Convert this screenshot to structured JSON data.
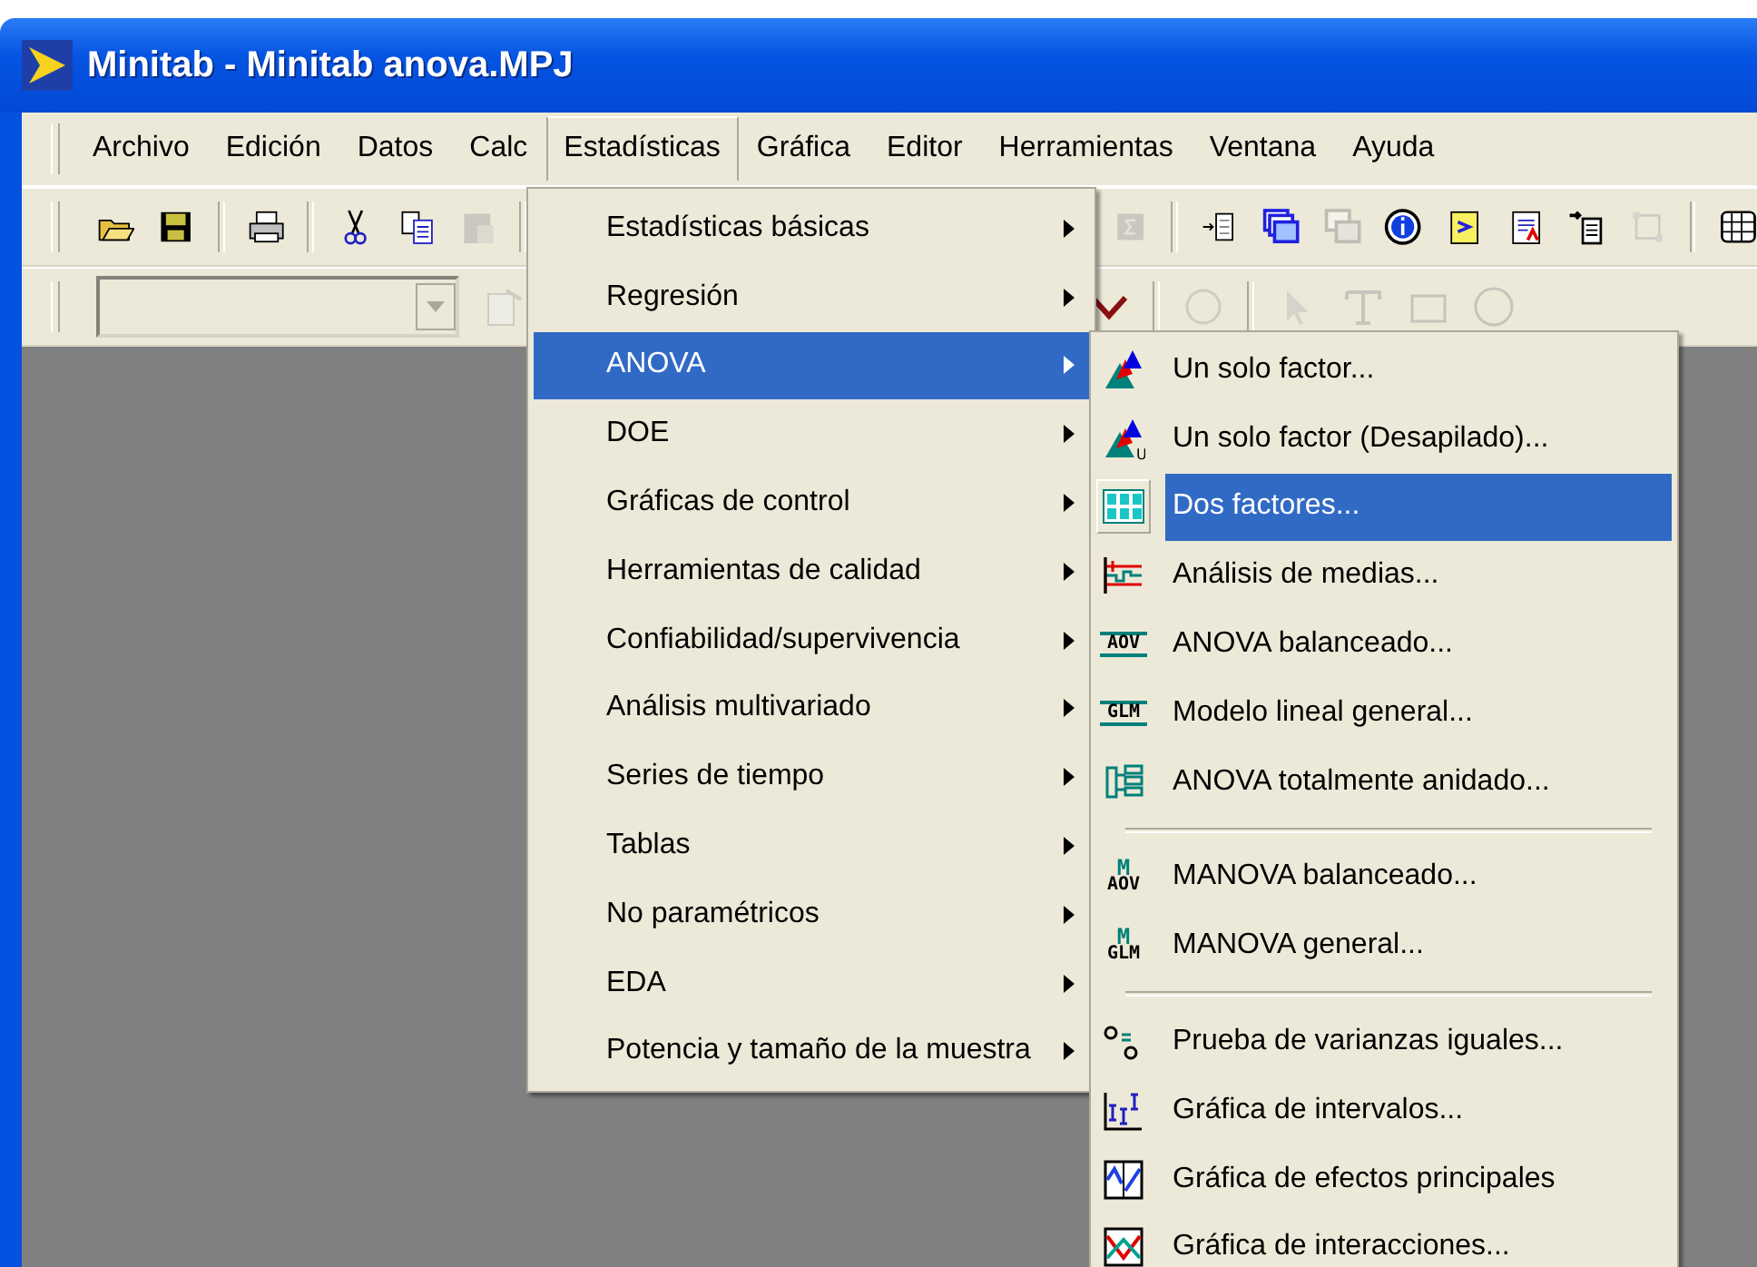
{
  "window": {
    "title": "Minitab - Minitab anova.MPJ"
  },
  "menu_bar": [
    {
      "label": "Archivo",
      "selected": false
    },
    {
      "label": "Edición",
      "selected": false
    },
    {
      "label": "Datos",
      "selected": false
    },
    {
      "label": "Calc",
      "selected": false
    },
    {
      "label": "Estadísticas",
      "selected": true
    },
    {
      "label": "Gráfica",
      "selected": false
    },
    {
      "label": "Editor",
      "selected": false
    },
    {
      "label": "Herramientas",
      "selected": false
    },
    {
      "label": "Ventana",
      "selected": false
    },
    {
      "label": "Ayuda",
      "selected": false
    }
  ],
  "stat_menu": {
    "items": [
      {
        "label": "Estadísticas básicas",
        "selected": false
      },
      {
        "label": "Regresión",
        "selected": false
      },
      {
        "label": "ANOVA",
        "selected": true
      },
      {
        "label": "DOE",
        "selected": false
      },
      {
        "label": "Gráficas de control",
        "selected": false
      },
      {
        "label": "Herramientas de calidad",
        "selected": false
      },
      {
        "label": "Confiabilidad/supervivencia",
        "selected": false
      },
      {
        "label": "Análisis multivariado",
        "selected": false
      },
      {
        "label": "Series de tiempo",
        "selected": false
      },
      {
        "label": "Tablas",
        "selected": false
      },
      {
        "label": "No paramétricos",
        "selected": false
      },
      {
        "label": "EDA",
        "selected": false
      },
      {
        "label": "Potencia y tamaño de la muestra",
        "selected": false
      }
    ]
  },
  "anova_menu": {
    "items": [
      {
        "kind": "item",
        "label": "Un solo factor...",
        "selected": false
      },
      {
        "kind": "item",
        "label": "Un solo factor (Desapilado)...",
        "selected": false,
        "icon_text": [
          "U"
        ]
      },
      {
        "kind": "item",
        "label": "Dos factores...",
        "selected": true
      },
      {
        "kind": "item",
        "label": "Análisis de medias...",
        "selected": false
      },
      {
        "kind": "item",
        "label": "ANOVA balanceado...",
        "selected": false,
        "icon_text": [
          "AOV"
        ]
      },
      {
        "kind": "item",
        "label": "Modelo lineal general...",
        "selected": false,
        "icon_text": [
          "GLM"
        ]
      },
      {
        "kind": "item",
        "label": "ANOVA totalmente anidado...",
        "selected": false
      },
      {
        "kind": "separator"
      },
      {
        "kind": "item",
        "label": "MANOVA balanceado...",
        "selected": false,
        "icon_text": [
          "M",
          "AOV"
        ]
      },
      {
        "kind": "item",
        "label": "MANOVA general...",
        "selected": false,
        "icon_text": [
          "M",
          "GLM"
        ]
      },
      {
        "kind": "separator"
      },
      {
        "kind": "item",
        "label": "Prueba de varianzas iguales...",
        "selected": false
      },
      {
        "kind": "item",
        "label": "Gráfica de intervalos...",
        "selected": false
      },
      {
        "kind": "item",
        "label": "Gráfica de efectos principales",
        "selected": false
      },
      {
        "kind": "item",
        "label": "Gráfica de interacciones...",
        "selected": false
      }
    ]
  }
}
